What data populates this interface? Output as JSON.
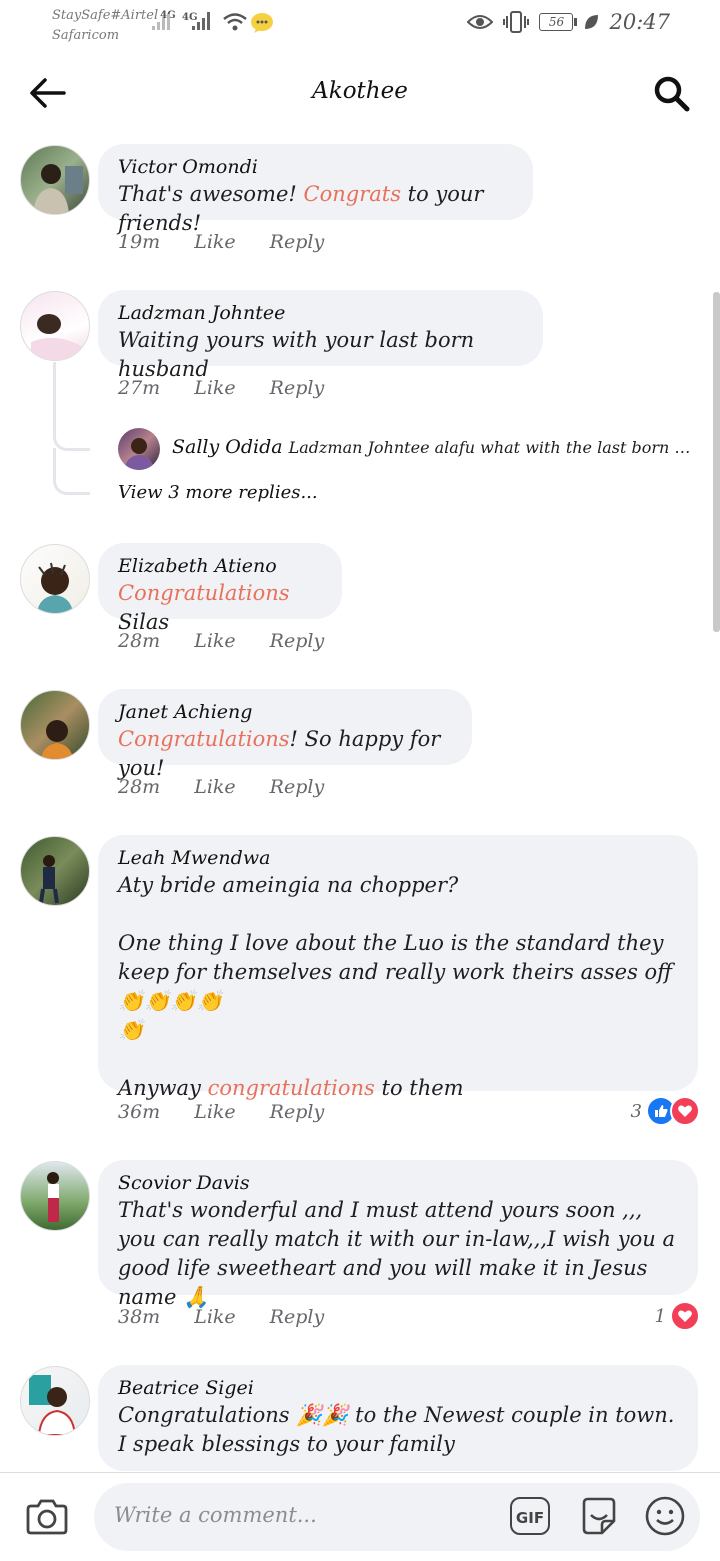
{
  "status": {
    "carrier1": "StaySafe#Airtel",
    "carrier2": "Safaricom",
    "net1": "4G",
    "net2": "4G",
    "battery": "56",
    "time": "20:47"
  },
  "header": {
    "title": "Akothee"
  },
  "comments": [
    {
      "author": "Victor Omondi",
      "pre": "That's awesome! ",
      "hl": "Congrats",
      "post": " to your friends!",
      "time": "19m",
      "like": "Like",
      "reply": "Reply"
    },
    {
      "author": "Ladzman Johntee",
      "pre": "Waiting yours with your last born husband",
      "hl": "",
      "post": "",
      "time": "27m",
      "like": "Like",
      "reply": "Reply"
    },
    {
      "author": "Elizabeth Atieno",
      "pre": "",
      "hl": "Congratulations",
      "post": " Silas",
      "time": "28m",
      "like": "Like",
      "reply": "Reply"
    },
    {
      "author": "Janet Achieng",
      "pre": "",
      "hl": "Congratulations",
      "post": "! So happy for you!",
      "time": "28m",
      "like": "Like",
      "reply": "Reply"
    },
    {
      "author": "Leah Mwendwa",
      "pre": "Aty bride ameingia na chopper?\n\nOne thing I love about the Luo is the standard they keep for themselves and really work theirs asses off👏👏👏👏\n👏\n\nAnyway ",
      "hl": "congratulations",
      "post": " to them",
      "time": "36m",
      "like": "Like",
      "reply": "Reply",
      "reaction_count": "3"
    },
    {
      "author": "Scovior Davis",
      "pre": "That's wonderful and I must attend yours soon ,,, you can really match it with our in-law,,,I wish you a good life sweetheart and you will make it in Jesus name 🙏",
      "hl": "",
      "post": "",
      "time": "38m",
      "like": "Like",
      "reply": "Reply",
      "reaction_count": "1"
    },
    {
      "author": "Beatrice Sigei",
      "pre": "Congratulations 🎉🎉 to the Newest couple in town. I speak blessings to your family",
      "hl": "",
      "post": ""
    }
  ],
  "reply_preview": {
    "author": "Sally Odida",
    "text": "Ladzman Johntee alafu what with the last born word, si..."
  },
  "more_replies": "View 3 more replies...",
  "composer": {
    "placeholder": "Write a comment...",
    "gif_label": "GIF"
  },
  "colors": {
    "highlight": "#e9715c",
    "like_blue": "#1877f2",
    "love_red": "#f33e58",
    "bubble": "#f0f2f5"
  }
}
